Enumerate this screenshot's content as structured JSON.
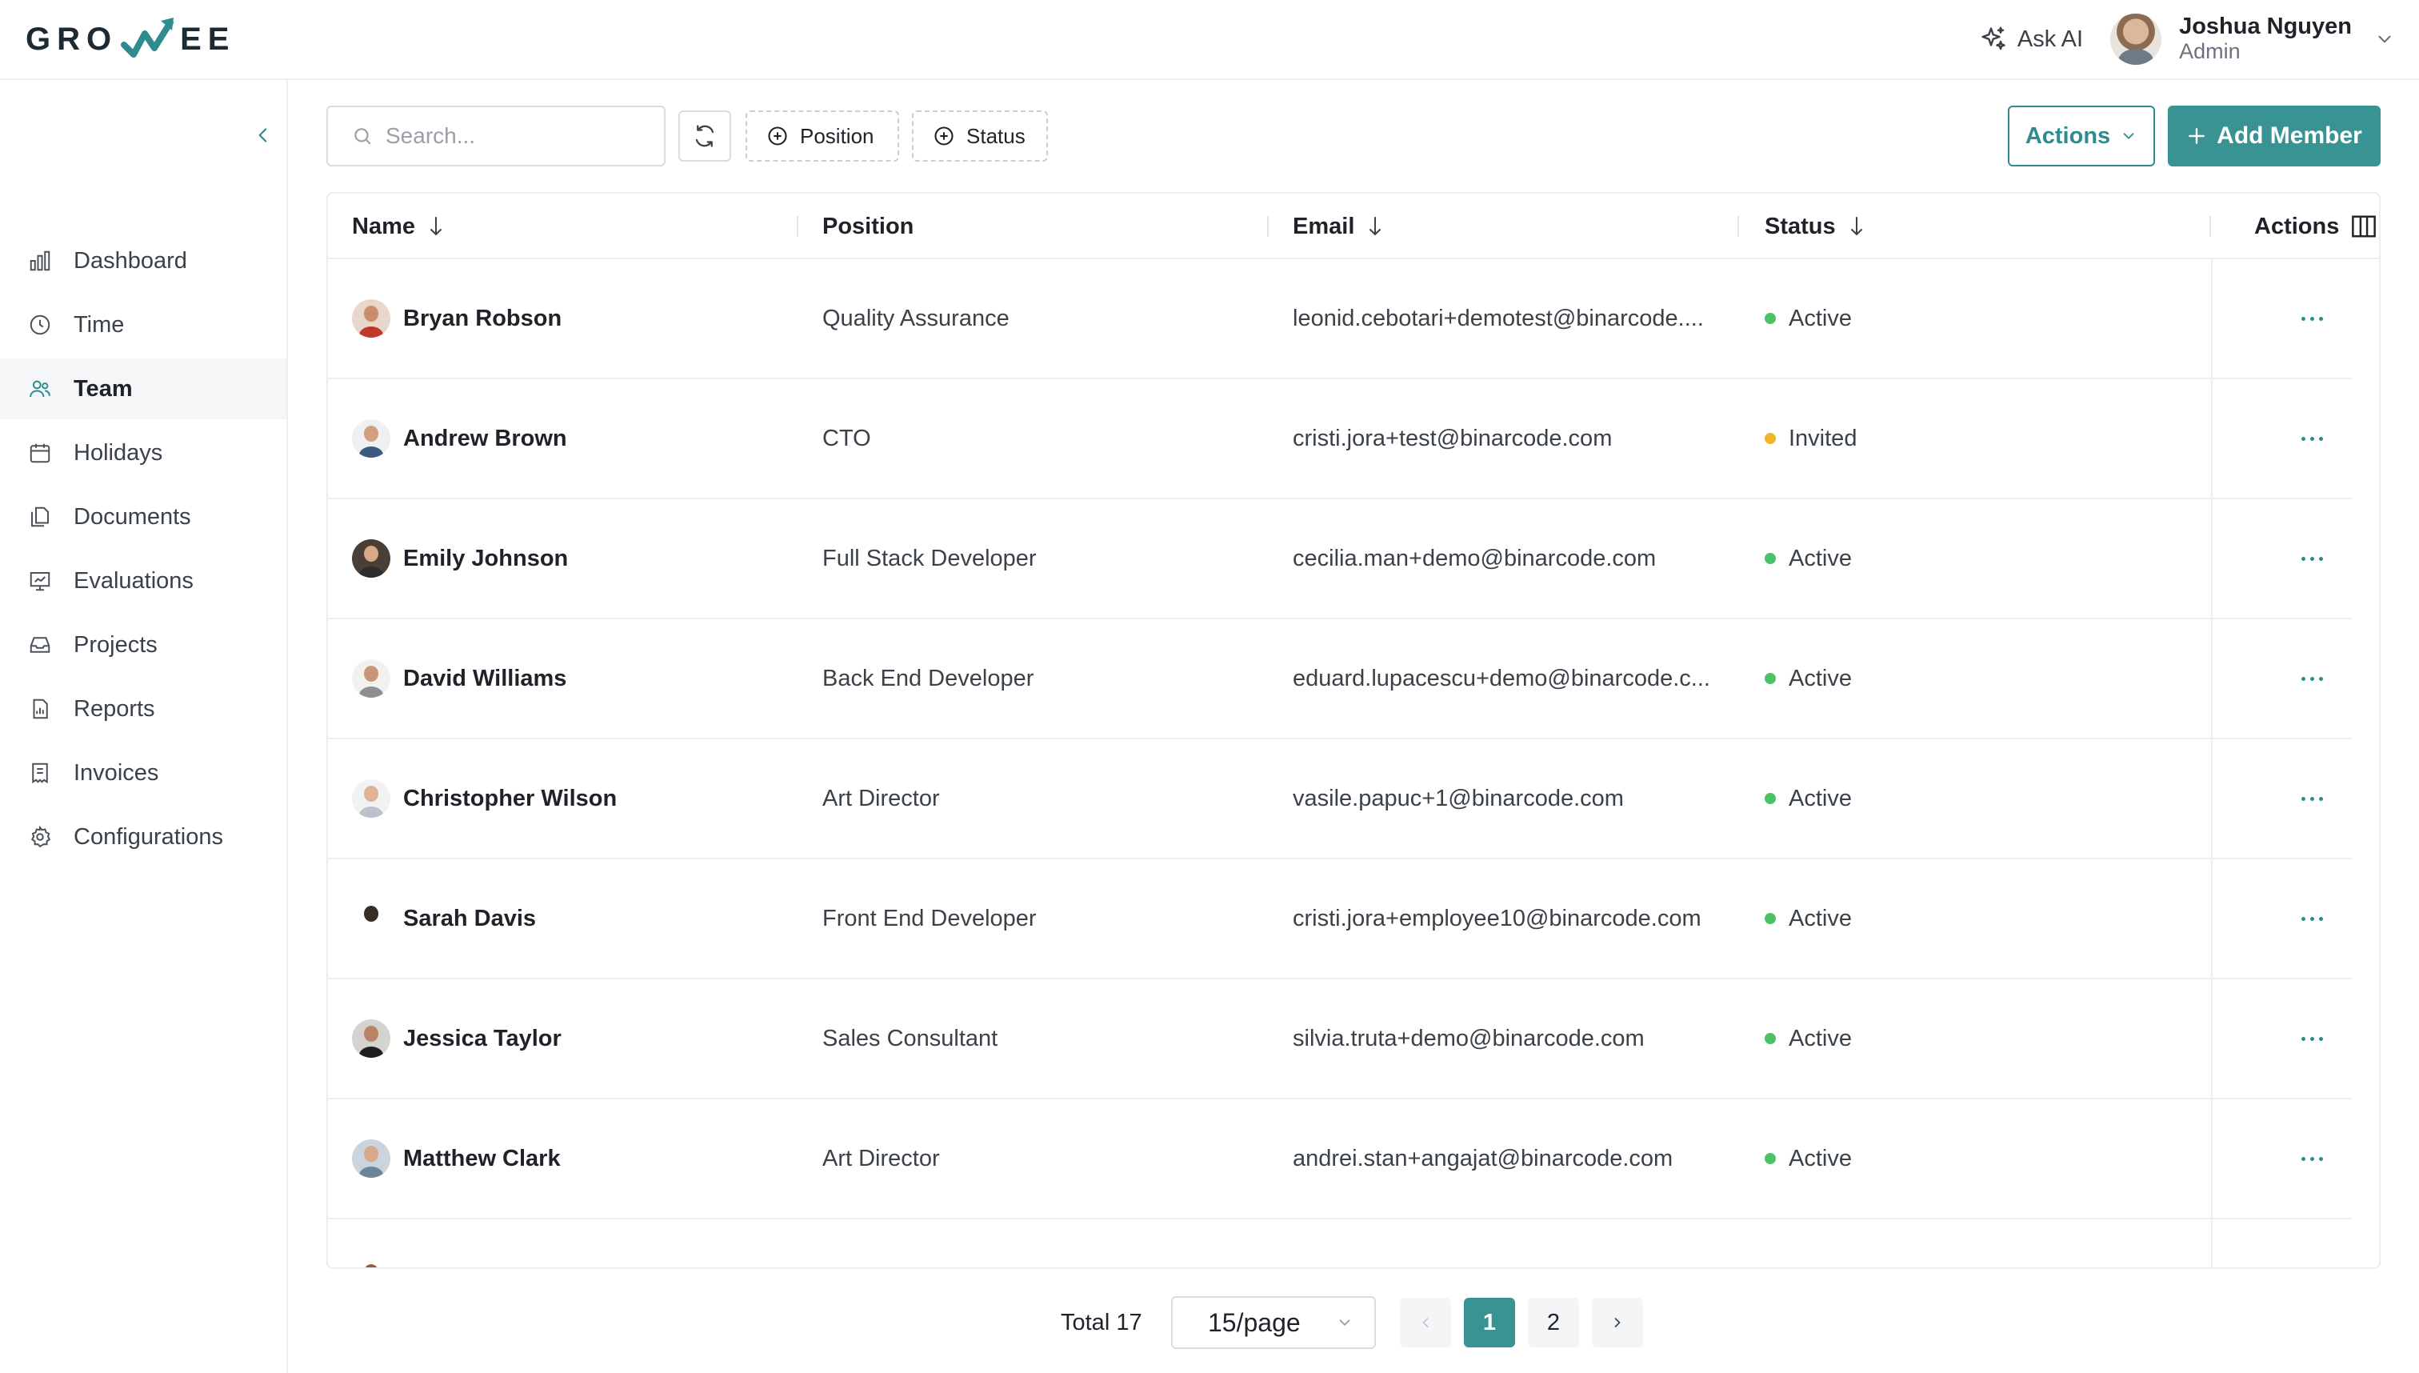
{
  "app": {
    "logo_left": "GRO",
    "logo_right": "EE"
  },
  "header": {
    "ask_ai_label": "Ask AI",
    "user_name": "Joshua Nguyen",
    "user_role": "Admin"
  },
  "sidebar": {
    "items": [
      {
        "label": "Dashboard",
        "icon": "bar-chart-icon",
        "active": false
      },
      {
        "label": "Time",
        "icon": "clock-icon",
        "active": false
      },
      {
        "label": "Team",
        "icon": "users-icon",
        "active": true
      },
      {
        "label": "Holidays",
        "icon": "calendar-icon",
        "active": false
      },
      {
        "label": "Documents",
        "icon": "documents-icon",
        "active": false
      },
      {
        "label": "Evaluations",
        "icon": "presentation-chart-icon",
        "active": false
      },
      {
        "label": "Projects",
        "icon": "inbox-icon",
        "active": false
      },
      {
        "label": "Reports",
        "icon": "report-icon",
        "active": false
      },
      {
        "label": "Invoices",
        "icon": "invoice-icon",
        "active": false
      },
      {
        "label": "Configurations",
        "icon": "gear-icon",
        "active": false
      }
    ]
  },
  "toolbar": {
    "search_placeholder": "Search...",
    "search_value": "",
    "filter_position_label": "Position",
    "filter_status_label": "Status",
    "actions_label": "Actions",
    "add_member_label": "Add Member"
  },
  "table": {
    "columns": {
      "name": "Name",
      "position": "Position",
      "email": "Email",
      "status": "Status",
      "actions": "Actions"
    },
    "rows": [
      {
        "name": "Bryan Robson",
        "position": "Quality Assurance",
        "email": "leonid.cebotari+demotest@binarcode....",
        "status": "Active"
      },
      {
        "name": "Andrew Brown",
        "position": "CTO",
        "email": "cristi.jora+test@binarcode.com",
        "status": "Invited"
      },
      {
        "name": "Emily Johnson",
        "position": "Full Stack Developer",
        "email": "cecilia.man+demo@binarcode.com",
        "status": "Active"
      },
      {
        "name": "David Williams",
        "position": "Back End Developer",
        "email": "eduard.lupacescu+demo@binarcode.c...",
        "status": "Active"
      },
      {
        "name": "Christopher Wilson",
        "position": "Art Director",
        "email": "vasile.papuc+1@binarcode.com",
        "status": "Active"
      },
      {
        "name": "Sarah Davis",
        "position": "Front End Developer",
        "email": "cristi.jora+employee10@binarcode.com",
        "status": "Active"
      },
      {
        "name": "Jessica Taylor",
        "position": "Sales Consultant",
        "email": "silvia.truta+demo@binarcode.com",
        "status": "Active"
      },
      {
        "name": "Matthew Clark",
        "position": "Art Director",
        "email": "andrei.stan+angajat@binarcode.com",
        "status": "Active"
      }
    ]
  },
  "pagination": {
    "total_label": "Total 17",
    "page_size": "15/page",
    "pages": [
      "1",
      "2"
    ],
    "current_page": "1"
  },
  "colors": {
    "accent": "#3a9393",
    "status_active": "#4cc267",
    "status_invited": "#f0b429"
  }
}
